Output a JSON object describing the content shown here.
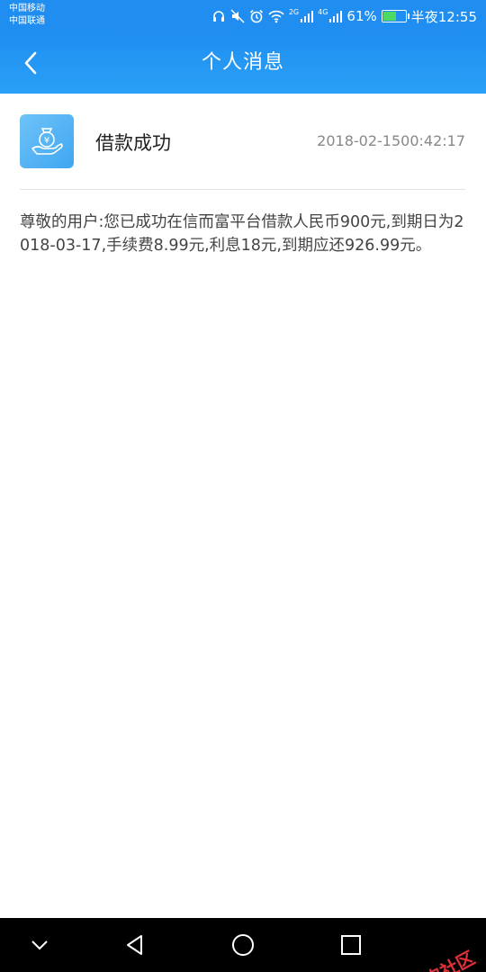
{
  "status_bar": {
    "carrier_1": "中国移动",
    "carrier_2": "中国联通",
    "net_1": "2G",
    "net_2": "4G",
    "battery_percent": "61%",
    "battery_level": 0.61,
    "time": "半夜12:55"
  },
  "header": {
    "title": "个人消息"
  },
  "message": {
    "title": "借款成功",
    "timestamp": "2018-02-1500:42:17",
    "body": "尊敬的用户:您已成功在信而富平台借款人民币900元,到期日为2018-03-17,手续费8.99元,利息18元,到期应还926.99元。",
    "icon": "money-bag-hand-icon"
  },
  "watermark": {
    "text": "卡农社区"
  },
  "colors": {
    "accent": "#1f8ef0",
    "watermark": "#e0303a"
  }
}
